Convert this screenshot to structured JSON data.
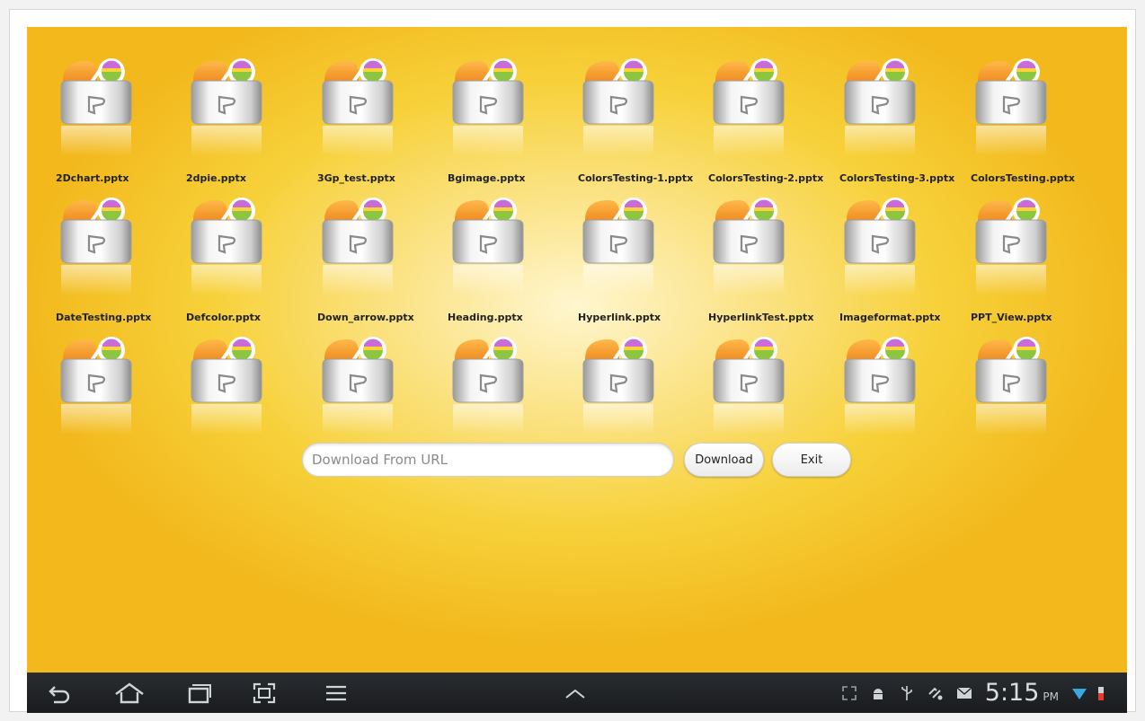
{
  "files": [
    {
      "name": "2Dchart.pptx"
    },
    {
      "name": "2dpie.pptx"
    },
    {
      "name": "3Gp_test.pptx"
    },
    {
      "name": "Bgimage.pptx"
    },
    {
      "name": "ColorsTesting-1.pptx"
    },
    {
      "name": "ColorsTesting-2.pptx"
    },
    {
      "name": "ColorsTesting-3.pptx"
    },
    {
      "name": "ColorsTesting.pptx"
    },
    {
      "name": "DateTesting.pptx"
    },
    {
      "name": "Defcolor.pptx"
    },
    {
      "name": "Down_arrow.pptx"
    },
    {
      "name": "Heading.pptx"
    },
    {
      "name": "Hyperlink.pptx"
    },
    {
      "name": "HyperlinkTest.pptx"
    },
    {
      "name": "Imageformat.pptx"
    },
    {
      "name": "PPT_View.pptx"
    },
    {
      "name": ""
    },
    {
      "name": ""
    },
    {
      "name": ""
    },
    {
      "name": ""
    },
    {
      "name": ""
    },
    {
      "name": ""
    },
    {
      "name": ""
    },
    {
      "name": ""
    }
  ],
  "download": {
    "placeholder": "Download From URL",
    "download_label": "Download",
    "exit_label": "Exit"
  },
  "navbar": {
    "icons": [
      "back-icon",
      "home-icon",
      "recent-apps-icon",
      "screenshot-icon",
      "menu-icon",
      "chevron-up-icon"
    ],
    "status_icons": [
      "expand-icon",
      "android-debug-icon",
      "usb-icon",
      "sync-icon",
      "email-icon",
      "wifi-icon",
      "battery-icon"
    ],
    "time": "5:15",
    "ampm": "PM"
  },
  "colors": {
    "background_center": "#fff6cf",
    "background_edge": "#f2b81c",
    "icon_orange": "#f39a1e",
    "navbar": "#1f2124"
  }
}
